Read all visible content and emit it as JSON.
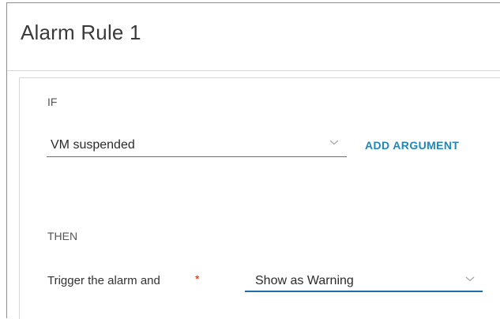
{
  "card": {
    "title": "Alarm Rule 1"
  },
  "condition": {
    "section_label": "IF",
    "selected_value": "VM suspended",
    "add_argument_label": "ADD ARGUMENT"
  },
  "action": {
    "section_label": "THEN",
    "trigger_label": "Trigger the alarm and",
    "required_marker": "*",
    "selected_value": "Show as Warning"
  },
  "icons": {
    "dropdown": "chevron-down-icon"
  },
  "colors": {
    "link_accent": "#1e88bd",
    "required": "#c92100",
    "active_underline": "#1d6ea6"
  }
}
